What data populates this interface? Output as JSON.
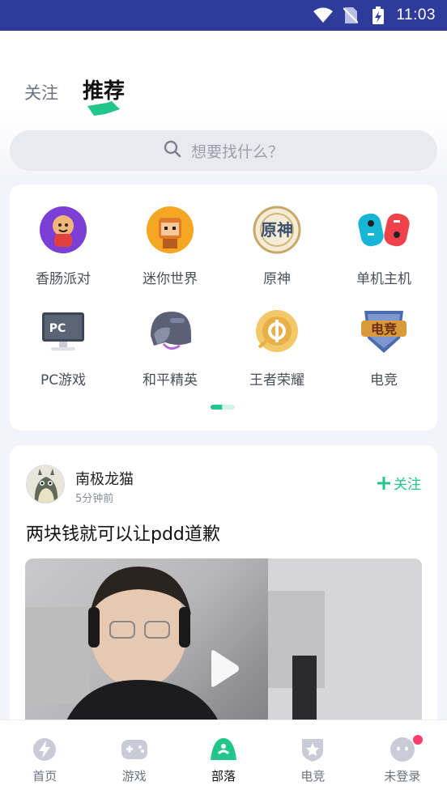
{
  "status_bar": {
    "time": "11:03"
  },
  "tabs": [
    {
      "label": "关注",
      "active": false
    },
    {
      "label": "推荐",
      "active": true
    }
  ],
  "search": {
    "placeholder": "想要找什么？"
  },
  "categories": [
    {
      "label": "香肠派对",
      "icon": "sausage-party-icon"
    },
    {
      "label": "迷你世界",
      "icon": "mini-world-icon"
    },
    {
      "label": "原神",
      "icon": "genshin-icon"
    },
    {
      "label": "单机主机",
      "icon": "console-controller-icon"
    },
    {
      "label": "PC游戏",
      "icon": "pc-monitor-icon"
    },
    {
      "label": "和平精英",
      "icon": "helmet-icon"
    },
    {
      "label": "王者荣耀",
      "icon": "honor-of-kings-icon"
    },
    {
      "label": "电竞",
      "icon": "esports-badge-icon"
    }
  ],
  "post": {
    "author": "南极龙猫",
    "time": "5分钟前",
    "follow_label": "关注",
    "title": "两块钱就可以让pdd道歉"
  },
  "bottom_nav": [
    {
      "label": "首页",
      "icon": "home-bolt-icon",
      "active": false
    },
    {
      "label": "游戏",
      "icon": "gamepad-icon",
      "active": false
    },
    {
      "label": "部落",
      "icon": "tribe-icon",
      "active": true
    },
    {
      "label": "电竞",
      "icon": "star-shield-icon",
      "active": false
    },
    {
      "label": "未登录",
      "icon": "user-face-icon",
      "active": false,
      "badge": true
    }
  ],
  "colors": {
    "accent": "#22c58b",
    "status_bar": "#2e3b9a",
    "badge": "#ff3e6c"
  }
}
